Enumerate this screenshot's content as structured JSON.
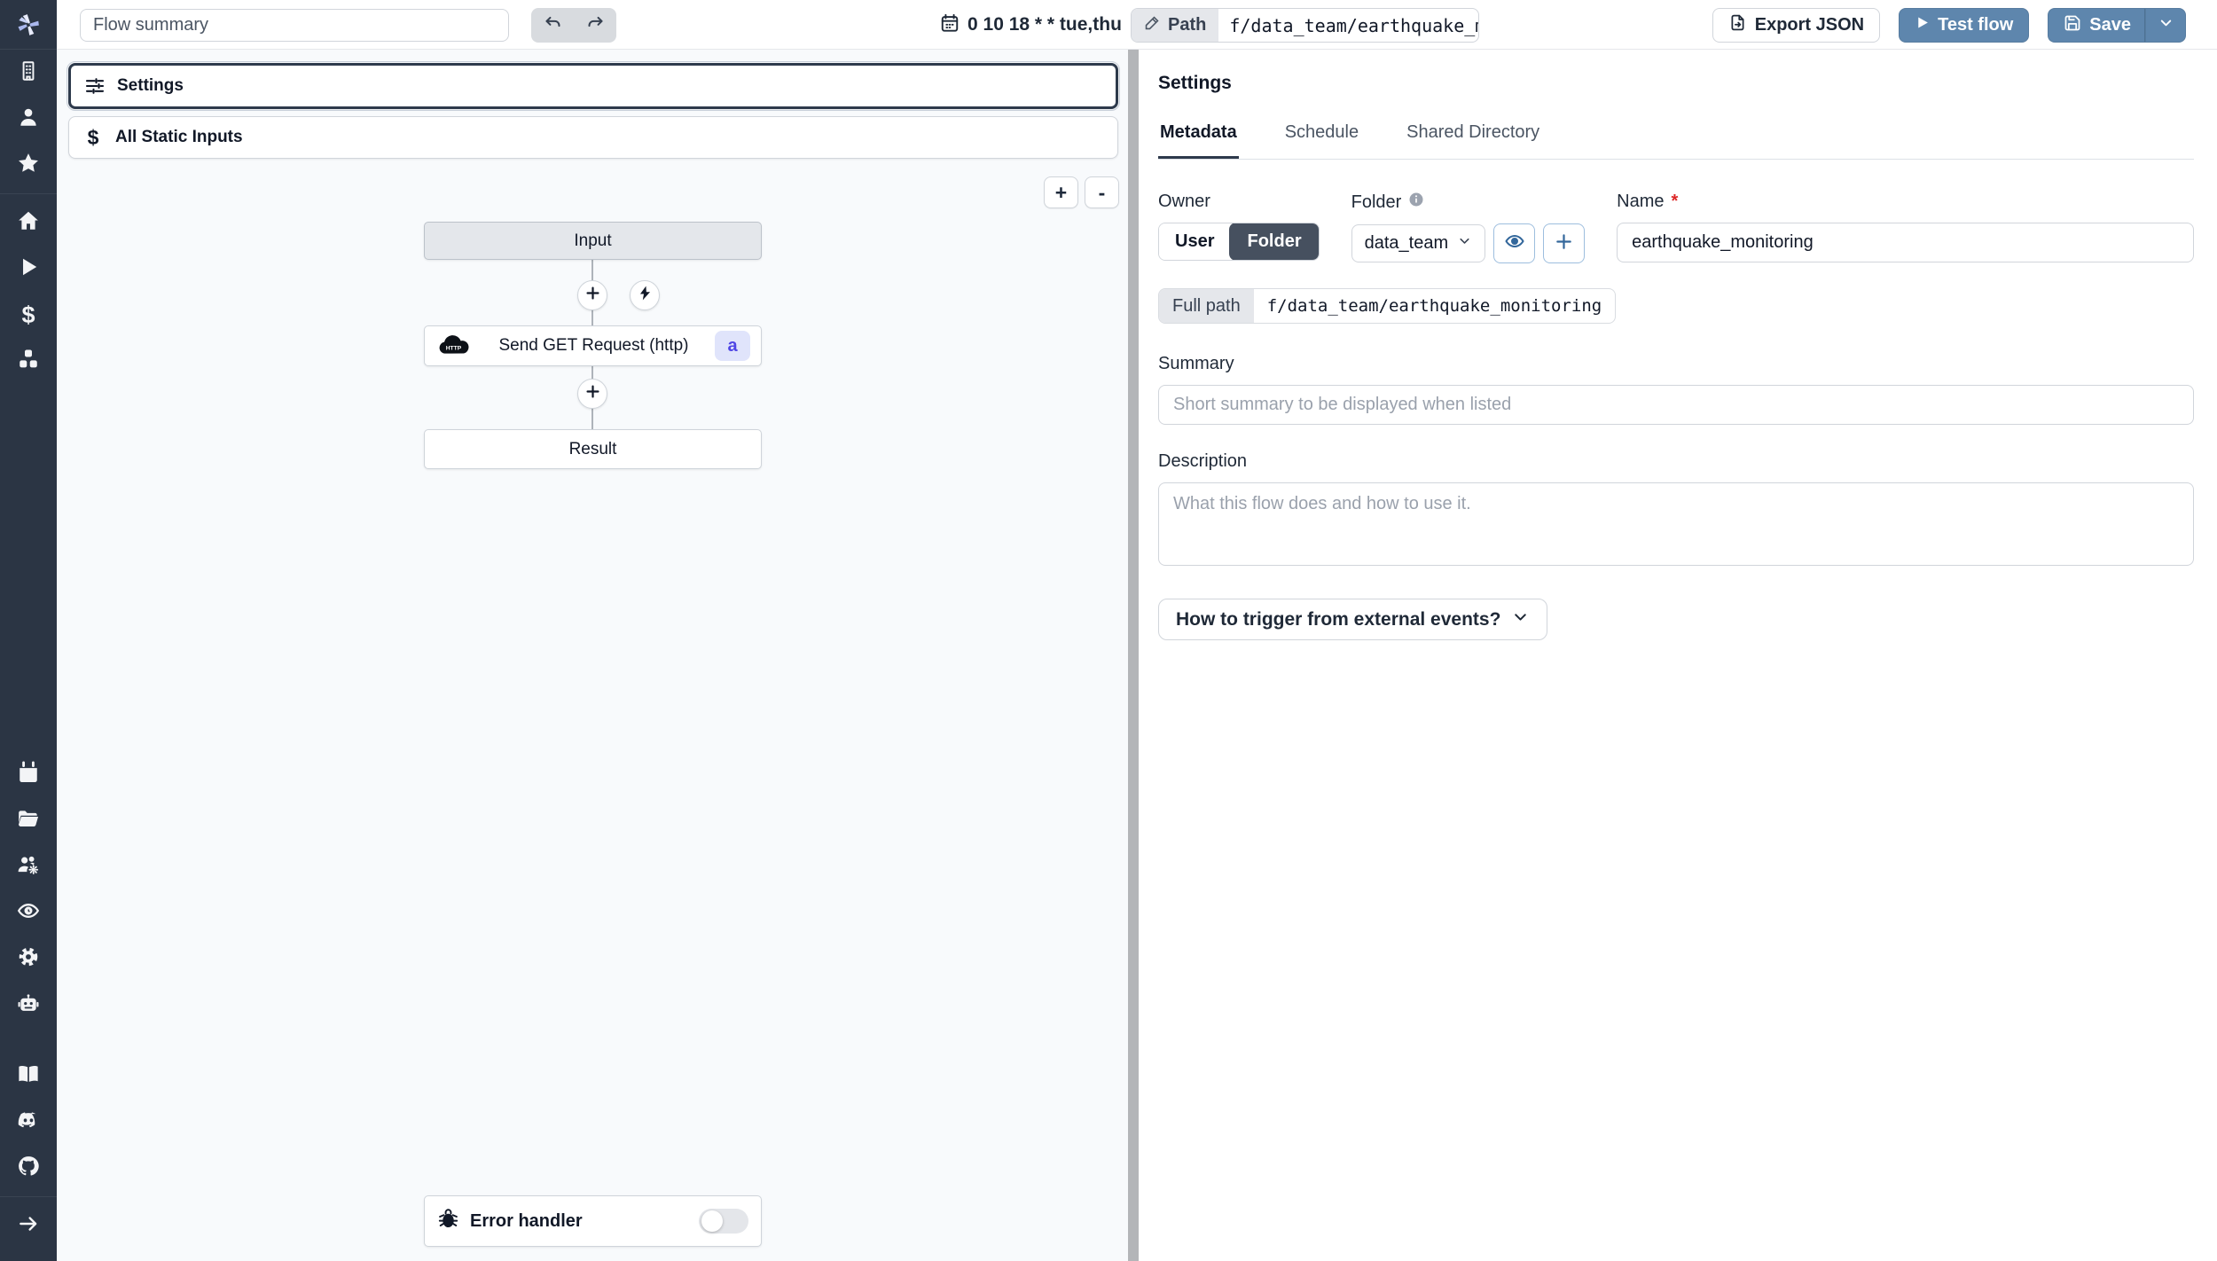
{
  "topbar": {
    "flow_summary_placeholder": "Flow summary",
    "schedule_cron": "0 10 18 * * tue,thu",
    "path_label": "Path",
    "path_value": "f/data_team/earthquake_monit",
    "export_json_label": "Export JSON",
    "test_flow_label": "Test flow",
    "save_label": "Save"
  },
  "flow_graph": {
    "settings_row_label": "Settings",
    "static_inputs_row_label": "All Static Inputs",
    "zoom_in_label": "+",
    "zoom_out_label": "-",
    "input_node_label": "Input",
    "http_node_label": "Send GET Request (http)",
    "http_node_badge": "a",
    "result_node_label": "Result",
    "error_handler_label": "Error handler"
  },
  "settings_panel": {
    "title": "Settings",
    "tabs": [
      {
        "label": "Metadata",
        "active": true
      },
      {
        "label": "Schedule",
        "active": false
      },
      {
        "label": "Shared Directory",
        "active": false
      }
    ],
    "owner_label": "Owner",
    "owner_user_label": "User",
    "owner_folder_label": "Folder",
    "folder_label": "Folder",
    "folder_value": "data_team",
    "name_label": "Name",
    "name_required_mark": "*",
    "name_value": "earthquake_monitoring",
    "full_path_label": "Full path",
    "full_path_value": "f/data_team/earthquake_monitoring",
    "summary_label": "Summary",
    "summary_placeholder": "Short summary to be displayed when listed",
    "description_label": "Description",
    "description_placeholder": "What this flow does and how to use it.",
    "trigger_button_label": "How to trigger from external events?"
  },
  "sidebar": {
    "icons": [
      "windmill-logo",
      "building",
      "user",
      "star",
      "home",
      "play",
      "dollar",
      "blocks",
      "calendar",
      "folder-open",
      "users-gear",
      "eye",
      "gear",
      "robot",
      "book-open",
      "discord",
      "github",
      "arrow-right"
    ]
  },
  "colors": {
    "accent_blue": "#5e86ad",
    "sidebar_bg": "#2b3544",
    "selected_border": "#2e3a4c",
    "badge_bg": "#e0e4fb",
    "badge_text": "#4f46e5"
  }
}
